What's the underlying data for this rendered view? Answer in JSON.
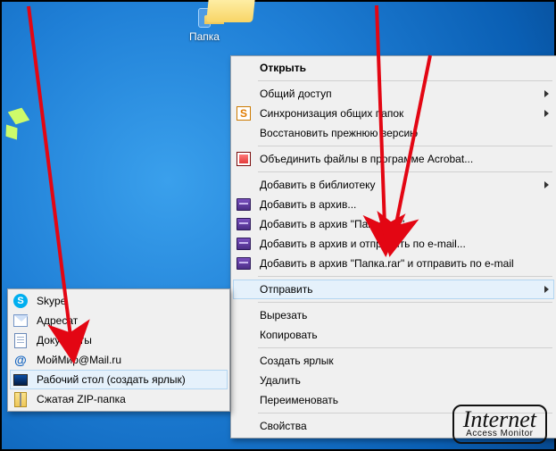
{
  "folder": {
    "label": "Папка"
  },
  "main_menu": {
    "items": [
      {
        "label": "Открыть",
        "bold": true
      },
      "sep",
      {
        "label": "Общий доступ",
        "submenu": true
      },
      {
        "label": "Синхронизация общих папок",
        "icon": "s",
        "submenu": true
      },
      {
        "label": "Восстановить прежнюю версию"
      },
      "sep",
      {
        "label": "Объединить файлы в программе Acrobat...",
        "icon": "pdf"
      },
      "sep",
      {
        "label": "Добавить в библиотеку",
        "submenu": true
      },
      {
        "label": "Добавить в архив...",
        "icon": "winrar"
      },
      {
        "label": "Добавить в архив \"Папка.rar\"",
        "icon": "winrar"
      },
      {
        "label": "Добавить в архив и отправить по e-mail...",
        "icon": "winrar"
      },
      {
        "label": "Добавить в архив \"Папка.rar\" и отправить по e-mail",
        "icon": "winrar"
      },
      "sep",
      {
        "label": "Отправить",
        "submenu": true,
        "hover": true
      },
      "sep",
      {
        "label": "Вырезать"
      },
      {
        "label": "Копировать"
      },
      "sep",
      {
        "label": "Создать ярлык"
      },
      {
        "label": "Удалить"
      },
      {
        "label": "Переименовать"
      },
      "sep",
      {
        "label": "Свойства"
      }
    ]
  },
  "send_menu": {
    "items": [
      {
        "label": "Skype",
        "icon": "skype"
      },
      {
        "label": "Адресат",
        "icon": "mail"
      },
      {
        "label": "Документы",
        "icon": "doc"
      },
      {
        "label": "МойМир@Mail.ru",
        "icon": "at"
      },
      {
        "label": "Рабочий стол (создать ярлык)",
        "icon": "desk",
        "hover": true
      },
      {
        "label": "Сжатая ZIP-папка",
        "icon": "zip"
      }
    ]
  },
  "watermark": {
    "line1": "Internet",
    "line2": "Access Monitor"
  }
}
